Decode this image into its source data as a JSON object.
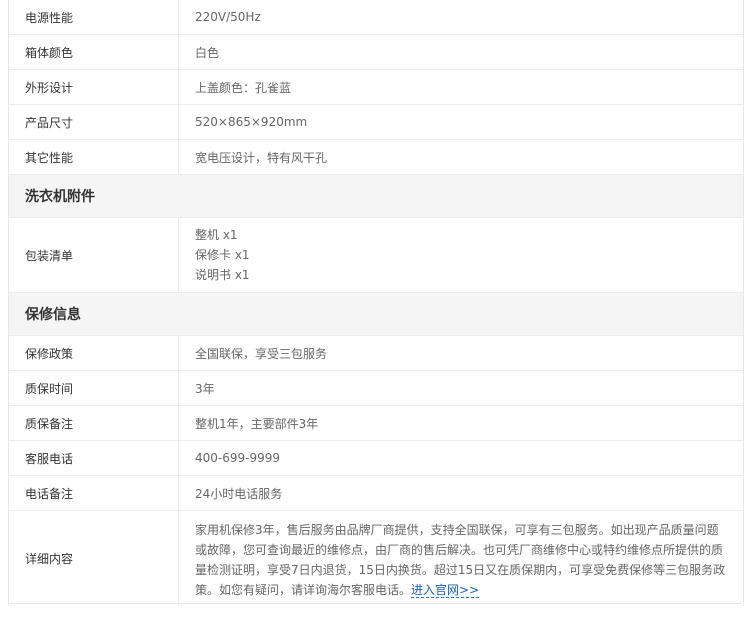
{
  "specs": [
    {
      "label": "电源性能",
      "value": "220V/50Hz"
    },
    {
      "label": "箱体颜色",
      "value": "白色"
    },
    {
      "label": "外形设计",
      "value": "上盖颜色：孔雀蓝"
    },
    {
      "label": "产品尺寸",
      "value": "520×865×920mm"
    },
    {
      "label": "其它性能",
      "value": "宽电压设计，特有风干孔"
    }
  ],
  "accessories": {
    "title": "洗衣机附件",
    "label": "包装清单",
    "items": [
      "整机 x1",
      "保修卡 x1",
      "说明书 x1"
    ]
  },
  "warranty": {
    "title": "保修信息",
    "rows": [
      {
        "label": "保修政策",
        "value": "全国联保，享受三包服务"
      },
      {
        "label": "质保时间",
        "value": "3年"
      },
      {
        "label": "质保备注",
        "value": "整机1年，主要部件3年"
      },
      {
        "label": "客服电话",
        "value": "400-699-9999"
      },
      {
        "label": "电话备注",
        "value": "24小时电话服务"
      }
    ],
    "detail": {
      "label": "详细内容",
      "text": "家用机保修3年，售后服务由品牌厂商提供，支持全国联保，可享有三包服务。如出现产品质量问题或故障，您可查询最近的维修点，由厂商的售后解决。也可凭厂商维修中心或特约维修点所提供的质量检测证明，享受7日内退货，15日内换货。超过15日又在质保期内，可享受免费保修等三包服务政策。如您有疑问，请详询海尔客服电话。",
      "link": "进入官网>>"
    }
  }
}
